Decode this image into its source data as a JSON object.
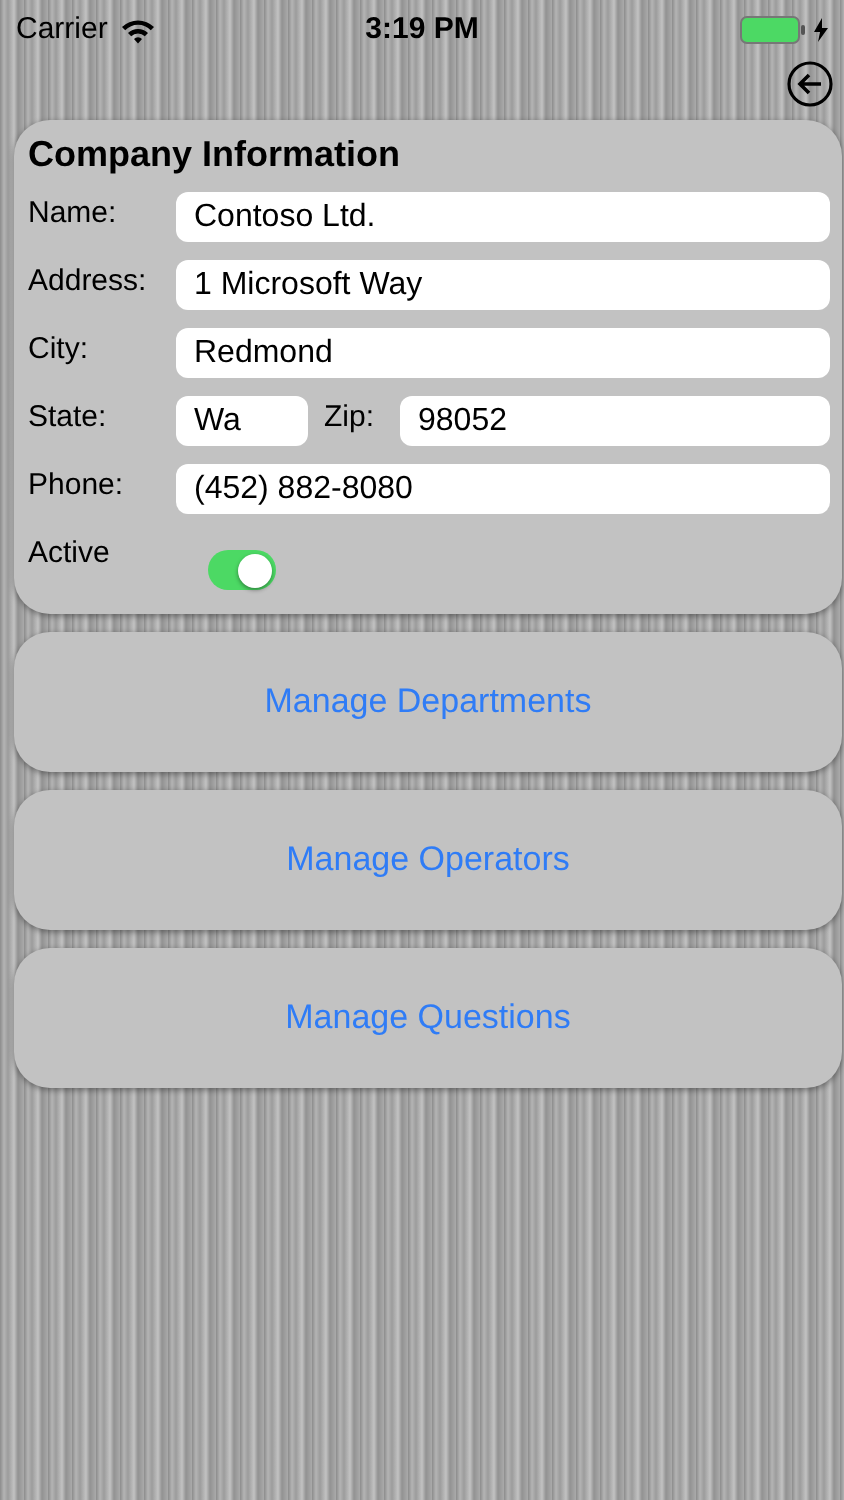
{
  "status_bar": {
    "carrier": "Carrier",
    "time": "3:19 PM",
    "charging": true
  },
  "company_info": {
    "title": "Company Information",
    "fields": [
      {
        "kind": "full",
        "label": "Name:",
        "value": "Contoso Ltd."
      },
      {
        "kind": "full",
        "label": "Address:",
        "value": "1 Microsoft Way"
      },
      {
        "kind": "full",
        "label": "City:",
        "value": "Redmond"
      },
      {
        "kind": "split",
        "label": "State:",
        "value": "Wa",
        "second_label": "Zip:",
        "second_value": "98052"
      },
      {
        "kind": "full",
        "label": "Phone:",
        "value": "(452) 882-8080"
      }
    ],
    "active": {
      "label": "Active",
      "on": true
    }
  },
  "buttons": [
    "Manage Departments",
    "Manage Operators",
    "Manage Questions"
  ]
}
